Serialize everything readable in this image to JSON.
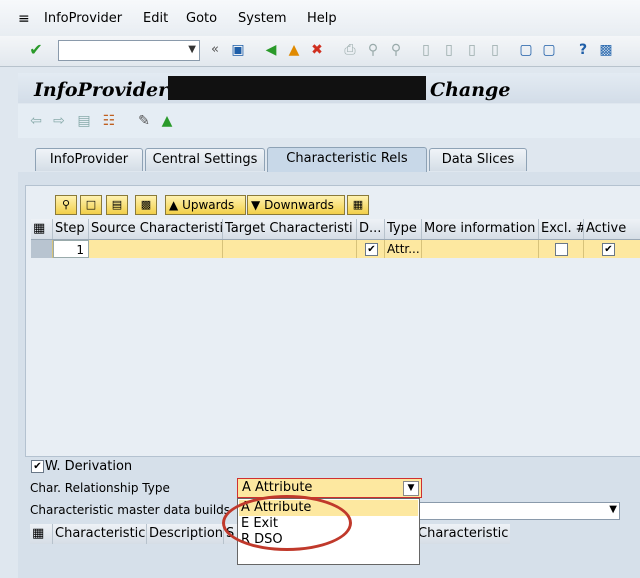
{
  "menu": {
    "items": [
      "InfoProvider",
      "Edit",
      "Goto",
      "System",
      "Help"
    ]
  },
  "toolbar": {
    "command_value": "",
    "double_left": "«"
  },
  "title": {
    "left": "InfoProvider",
    "right": "Change"
  },
  "tabs": [
    "InfoProvider",
    "Central Settings",
    "Characteristic Rels",
    "Data Slices"
  ],
  "table_toolbar": {
    "upwards_label": "Upwards",
    "downwards_label": "Downwards"
  },
  "table": {
    "columns": [
      "Step",
      "Source Characteristi",
      "Target Characteristi",
      "D...",
      "Type",
      "More information",
      "Excl. #",
      "Active"
    ],
    "rows": [
      {
        "step": "1",
        "source": "",
        "target": "",
        "d_checked": true,
        "type": "Attr...",
        "more_info": "",
        "excl_checked": false,
        "active_checked": true
      }
    ]
  },
  "derivation": {
    "label": "W. Derivation",
    "checked": true
  },
  "char_rel_type": {
    "label": "Char. Relationship Type",
    "value": "A Attribute",
    "options": [
      "A Attribute",
      "E Exit",
      "R DSO"
    ]
  },
  "master_data": {
    "label": "Characteristic master data builds",
    "value": ""
  },
  "lower_table": {
    "columns": [
      "Characteristic",
      "Description",
      "S",
      "Characteristic"
    ]
  },
  "colors": {
    "selection": "#fde8a0",
    "annotation_circle": "#c0392b"
  }
}
